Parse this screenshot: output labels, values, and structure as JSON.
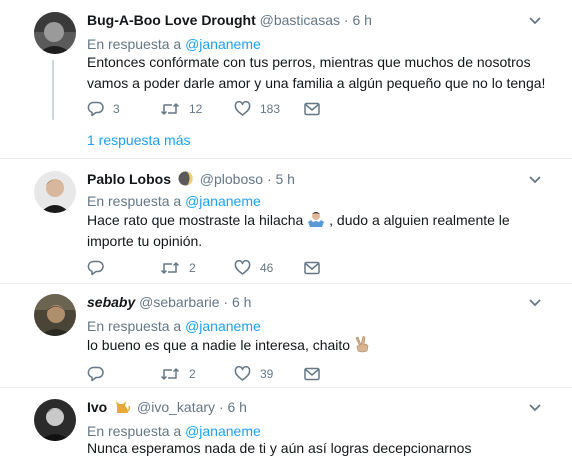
{
  "tweets": [
    {
      "name": "Bug-A-Boo Love Drought",
      "handle": "@basticasas",
      "dot": "·",
      "time": "6 h",
      "reply_prefix": "En respuesta a",
      "reply_mention": "@jananeme",
      "text": "Entonces confórmate con tus perros, mientras que muchos de nosotros vamos a poder darle amor y una familia a algún pequeño que no lo tenga!",
      "replies": "3",
      "retweets": "12",
      "likes": "183",
      "show_more": "1 respuesta más"
    },
    {
      "name": "Pablo Lobos",
      "handle": "@ploboso",
      "dot": "·",
      "time": "5 h",
      "reply_prefix": "En respuesta a",
      "reply_mention": "@jananeme",
      "text_before_emoji": "Hace rato que mostraste la hilacha",
      "text_after_emoji": ", dudo a alguien realmente le importe tu opinión.",
      "replies": "",
      "retweets": "2",
      "likes": "46"
    },
    {
      "name": "sebaby",
      "handle": "@sebarbarie",
      "dot": "·",
      "time": "6 h",
      "reply_prefix": "En respuesta a",
      "reply_mention": "@jananeme",
      "text": "lo bueno es que a nadie le interesa, chaito",
      "replies": "",
      "retweets": "2",
      "likes": "39"
    },
    {
      "name": "Ivo",
      "handle": "@ivo_katary",
      "dot": "·",
      "time": "6 h",
      "reply_prefix": "En respuesta a",
      "reply_mention": "@jananeme",
      "text": "Nunca esperamos nada de ti y aún así logras decepcionarnos"
    }
  ],
  "colors": {
    "accent": "#1da1f2",
    "secondary_text": "#657786",
    "divider": "#e6ecf0"
  },
  "icons": [
    "reply-icon",
    "retweet-icon",
    "like-icon",
    "direct-message-icon",
    "caret-down-icon",
    "moon-icon",
    "cat-icon"
  ]
}
